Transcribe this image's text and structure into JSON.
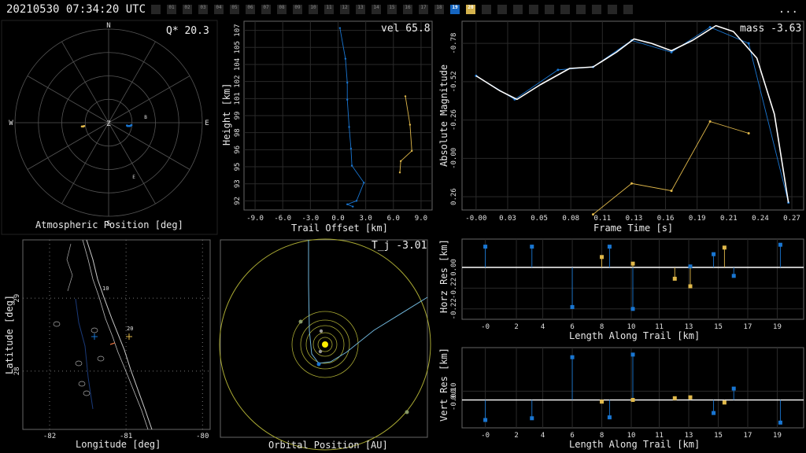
{
  "header": {
    "timestamp": "20210530 07:34:20 UTC",
    "menu_label": "..."
  },
  "frame_strip": {
    "labels": [
      "",
      "01",
      "02",
      "03",
      "04",
      "05",
      "06",
      "07",
      "08",
      "09",
      "10",
      "11",
      "12",
      "13",
      "14",
      "15",
      "16",
      "17",
      "18",
      "19",
      "20",
      "",
      "",
      "",
      "",
      "",
      "",
      "",
      "",
      "",
      ""
    ],
    "highlight_blue": "19",
    "highlight_yellow": "20"
  },
  "colors": {
    "site1": "#1976d2",
    "site2": "#e0b84a",
    "fit": "#ffffff",
    "orbit": "#aaaa33",
    "sun": "#ffee00"
  },
  "panels": {
    "polar": {
      "title": "Atmospheric Position [deg]",
      "annotation": "Q* 20.3",
      "compass": [
        "N",
        "E",
        "S",
        "W",
        "Z"
      ],
      "markers": [
        "B",
        "E"
      ]
    },
    "height": {
      "ylabel": "Height [km]",
      "xlabel": "Trail Offset [km]",
      "annotation": "vel 65.8"
    },
    "mag": {
      "ylabel": "Absolute Magnitude",
      "xlabel": "Frame Time [s]",
      "annotation": "mass -3.63"
    },
    "map": {
      "ylabel": "Latitude [deg]",
      "xlabel": "Longitude [deg]",
      "marker_labels": [
        "10",
        "20"
      ]
    },
    "orbit": {
      "xlabel": "Orbital Position [AU]",
      "annotation": "T_j -3.01"
    },
    "horz": {
      "ylabel": "Horz Res [km]",
      "xlabel": "Length Along Trail [km]"
    },
    "vert": {
      "ylabel": "Vert Res [km]",
      "xlabel": "Length Along Trail [km]"
    }
  },
  "chart_data": [
    {
      "type": "scatter",
      "name": "Atmospheric Position",
      "title": "Atmospheric Position [deg]",
      "series": [
        {
          "x": [
            -25,
            -24,
            -23,
            -22
          ],
          "y": [
            -8,
            -8,
            -8,
            -7
          ]
        },
        {
          "x": [
            17,
            18,
            20,
            21,
            22,
            23
          ],
          "y": [
            -6,
            -7,
            -7,
            -7,
            -6,
            -5
          ]
        }
      ]
    },
    {
      "type": "line",
      "name": "Height vs Trail Offset",
      "xlabel": "Trail Offset [km]",
      "ylabel": "Height [km]",
      "xticks": [
        "-9.0",
        "-6.0",
        "-3.0",
        "0.0",
        "3.0",
        "6.0",
        "9.0"
      ],
      "yticks": [
        "92",
        "93",
        "95",
        "96",
        "98",
        "99",
        "101",
        "102",
        "104",
        "105",
        "107"
      ],
      "xlim": [
        -10.2,
        10.2
      ],
      "ylim": [
        91.2,
        107.8
      ],
      "series": [
        {
          "x": [
            0.2,
            0.8,
            1.0,
            1.0,
            1.2,
            1.4,
            1.5,
            2.8,
            2.0,
            1.0,
            1.6
          ],
          "y": [
            107.2,
            104.5,
            102.4,
            100.9,
            98.5,
            96.6,
            95.1,
            93.6,
            92.0,
            91.7,
            91.5
          ]
        },
        {
          "x": [
            7.3,
            7.8,
            8.0,
            6.8,
            6.7
          ],
          "y": [
            101.2,
            98.7,
            96.4,
            95.5,
            94.5
          ]
        }
      ]
    },
    {
      "type": "line",
      "name": "Absolute Magnitude vs Frame Time",
      "xlabel": "Frame Time [s]",
      "ylabel": "Absolute Magnitude",
      "xticks": [
        "-0.00",
        "0.03",
        "0.05",
        "0.08",
        "0.11",
        "0.13",
        "0.16",
        "0.19",
        "0.21",
        "0.24",
        "0.27"
      ],
      "yticks": [
        "-0.78",
        "-0.52",
        "-0.26",
        "-0.00",
        "0.26"
      ],
      "xlim": [
        -0.012,
        0.28
      ],
      "ylim": [
        -0.93,
        0.35
      ],
      "series": [
        {
          "x": [
            0.0,
            0.033,
            0.07,
            0.1,
            0.133,
            0.167,
            0.2,
            0.233,
            0.267
          ],
          "y": [
            -0.56,
            -0.4,
            -0.6,
            -0.62,
            -0.8,
            -0.72,
            -0.89,
            -0.78,
            0.3
          ]
        },
        {
          "x": [
            0.1,
            0.133,
            0.167,
            0.2,
            0.233
          ],
          "y": [
            0.38,
            0.17,
            0.22,
            -0.25,
            -0.17
          ]
        }
      ]
    },
    {
      "type": "bar",
      "name": "Horizontal Residuals",
      "xlabel": "Length Along Trail [km]",
      "ylabel": "Horz Res [km]",
      "xticks": [
        "-0",
        "2",
        "4",
        "6",
        "8",
        "10",
        "11",
        "13",
        "15",
        "17",
        "19"
      ],
      "yticks": [
        "0.00",
        "-0.22",
        "-0.22"
      ],
      "series": [
        {
          "x": [
            0,
            3,
            5.6,
            8.0,
            9.5,
            13.2,
            14.7,
            16.0,
            19.0
          ],
          "y": [
            0.22,
            0.22,
            -0.42,
            0.22,
            -0.44,
            0.01,
            0.14,
            -0.09,
            0.24
          ]
        },
        {
          "x": [
            7.5,
            9.5,
            12.2,
            13.2,
            15.4
          ],
          "y": [
            0.11,
            0.04,
            -0.12,
            -0.2,
            0.21
          ]
        }
      ]
    },
    {
      "type": "bar",
      "name": "Vertical Residuals",
      "xlabel": "Length Along Trail [km]",
      "ylabel": "Vert Res [km]",
      "xticks": [
        "-0",
        "2",
        "4",
        "6",
        "8",
        "10",
        "11",
        "13",
        "15",
        "17",
        "19"
      ],
      "yticks": [
        "0.10",
        "-0.00"
      ],
      "series": [
        {
          "x": [
            0,
            3,
            5.6,
            8.0,
            9.5,
            14.7,
            16.0,
            19.0
          ],
          "y": [
            -0.23,
            -0.21,
            0.49,
            -0.2,
            0.52,
            -0.15,
            0.13,
            -0.26
          ]
        },
        {
          "x": [
            7.5,
            9.5,
            12.2,
            13.2,
            15.4
          ],
          "y": [
            -0.02,
            0.0,
            0.02,
            0.03,
            -0.03
          ]
        }
      ]
    }
  ]
}
